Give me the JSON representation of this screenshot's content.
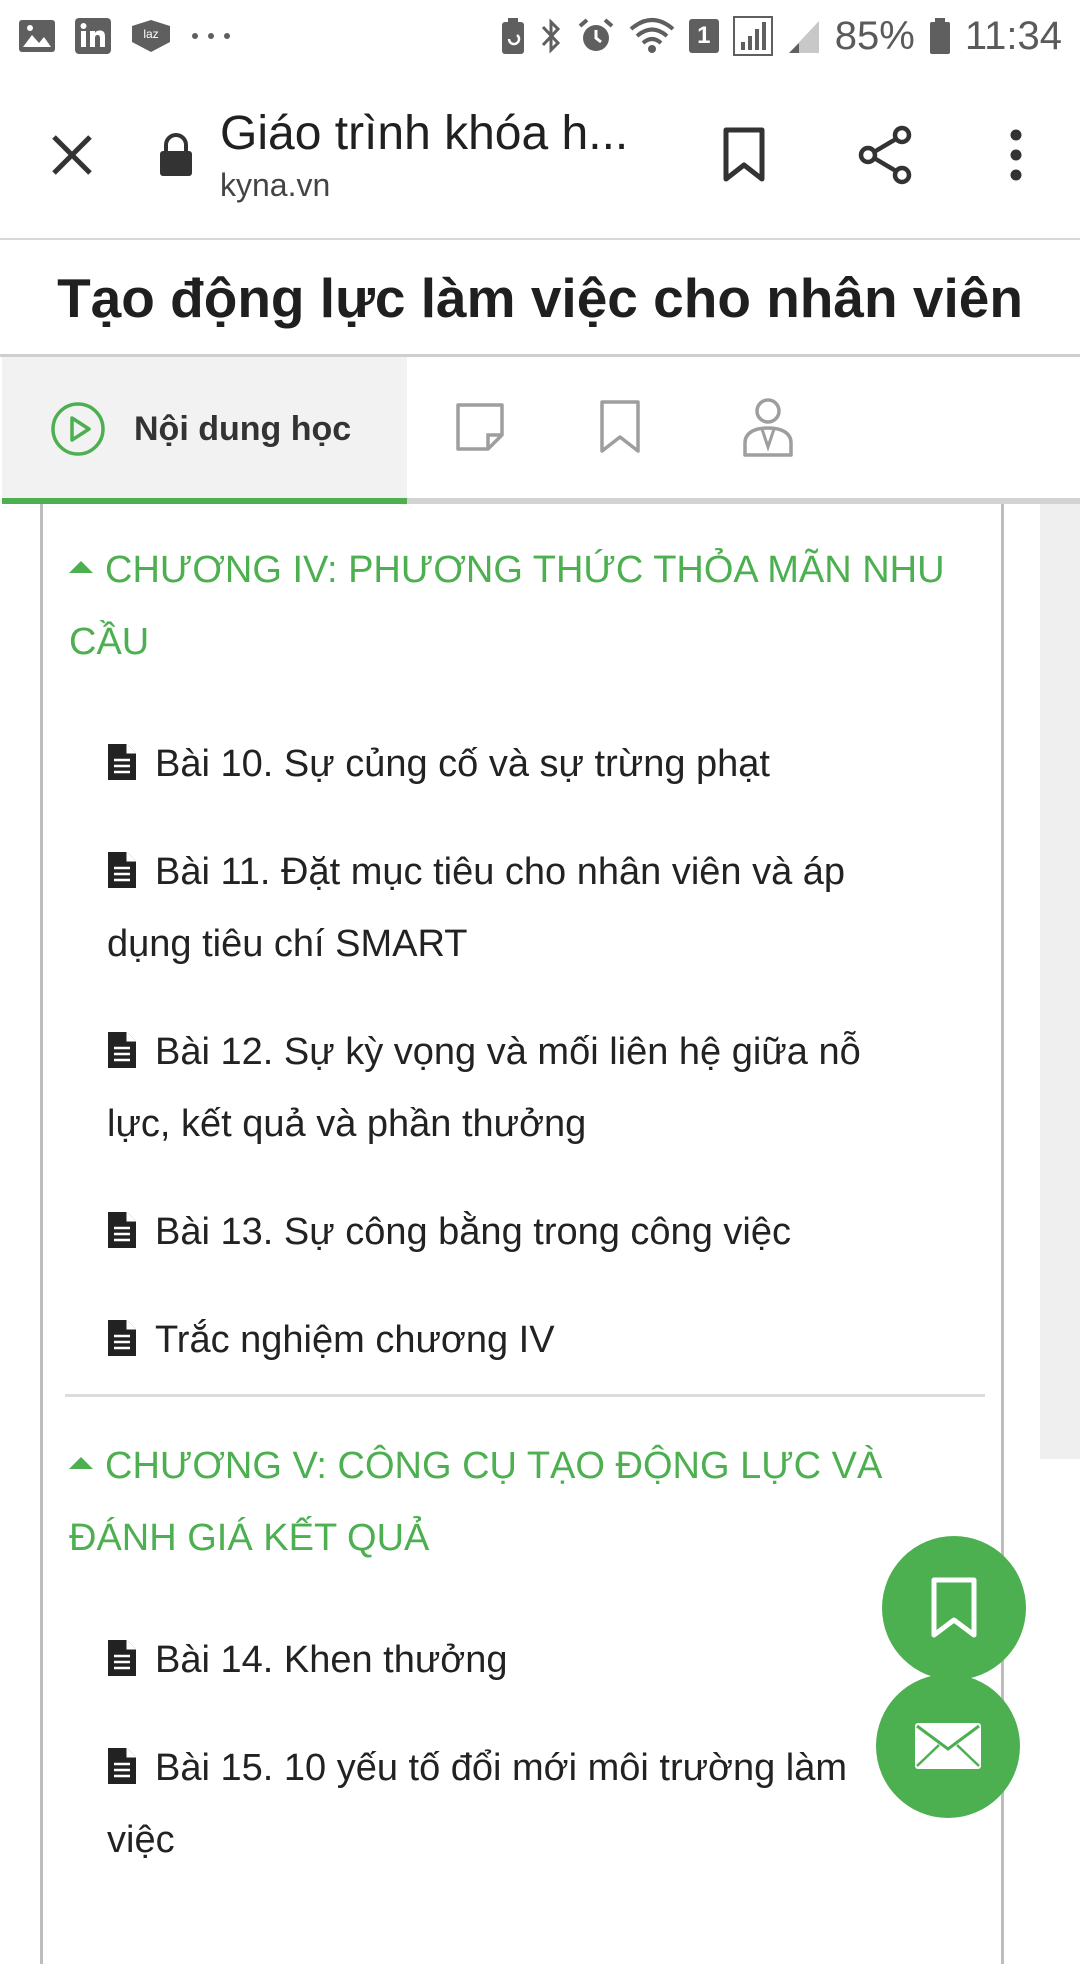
{
  "status_bar": {
    "battery_percent": "85%",
    "time": "11:34",
    "sim_slot": "1",
    "left_icons": [
      "gallery-icon",
      "linkedin-icon",
      "lazada-icon",
      "more-dots-icon"
    ],
    "right_icons": [
      "battery-saver-icon",
      "bluetooth-icon",
      "alarm-icon",
      "wifi-icon",
      "sim-icon",
      "signal-icon",
      "signal2-icon",
      "battery-icon"
    ]
  },
  "toolbar": {
    "title": "Giáo trình khóa h...",
    "url": "kyna.vn"
  },
  "page": {
    "title": "Tạo động lực làm việc cho nhân viên"
  },
  "tabs": {
    "active_label": "Nội dung học",
    "icons": [
      "play-circle-icon",
      "note-icon",
      "bookmark-icon",
      "teacher-icon"
    ]
  },
  "chapters": [
    {
      "title_line1": "CHƯƠNG IV: PHƯƠNG THỨC THỎA MÃN NHU",
      "title_line2": "CẦU",
      "lessons": [
        {
          "line1": "Bài 10. Sự củng cố và sự trừng phạt"
        },
        {
          "line1": "Bài 11. Đặt mục tiêu cho nhân viên và áp",
          "line2": "dụng tiêu chí SMART"
        },
        {
          "line1": "Bài 12. Sự kỳ vọng và mối liên hệ giữa nỗ",
          "line2": "lực, kết quả và phần thưởng"
        },
        {
          "line1": "Bài 13. Sự công bằng trong công việc"
        },
        {
          "line1": "Trắc nghiệm chương IV"
        }
      ]
    },
    {
      "title_line1": "CHƯƠNG V: CÔNG CỤ TẠO ĐỘNG LỰC VÀ",
      "title_line2": "ĐÁNH GIÁ KẾT QUẢ",
      "lessons": [
        {
          "line1": "Bài 14. Khen thưởng"
        },
        {
          "line1": "Bài 15. 10 yếu tố đổi mới môi trường làm",
          "line2": "việc"
        }
      ]
    }
  ],
  "colors": {
    "accent": "#4caf50",
    "text": "#222222",
    "divider": "#dcdcdc"
  }
}
